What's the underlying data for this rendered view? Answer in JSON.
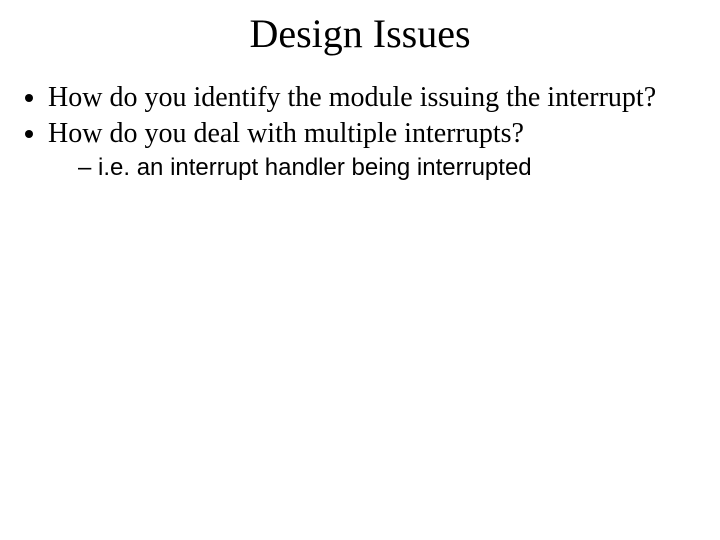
{
  "slide": {
    "title": "Design Issues",
    "bullets": [
      {
        "text": "How do you identify the module issuing the interrupt?"
      },
      {
        "text": "How do you deal with multiple interrupts?",
        "sub": [
          {
            "text": "i.e. an interrupt handler being interrupted"
          }
        ]
      }
    ]
  }
}
